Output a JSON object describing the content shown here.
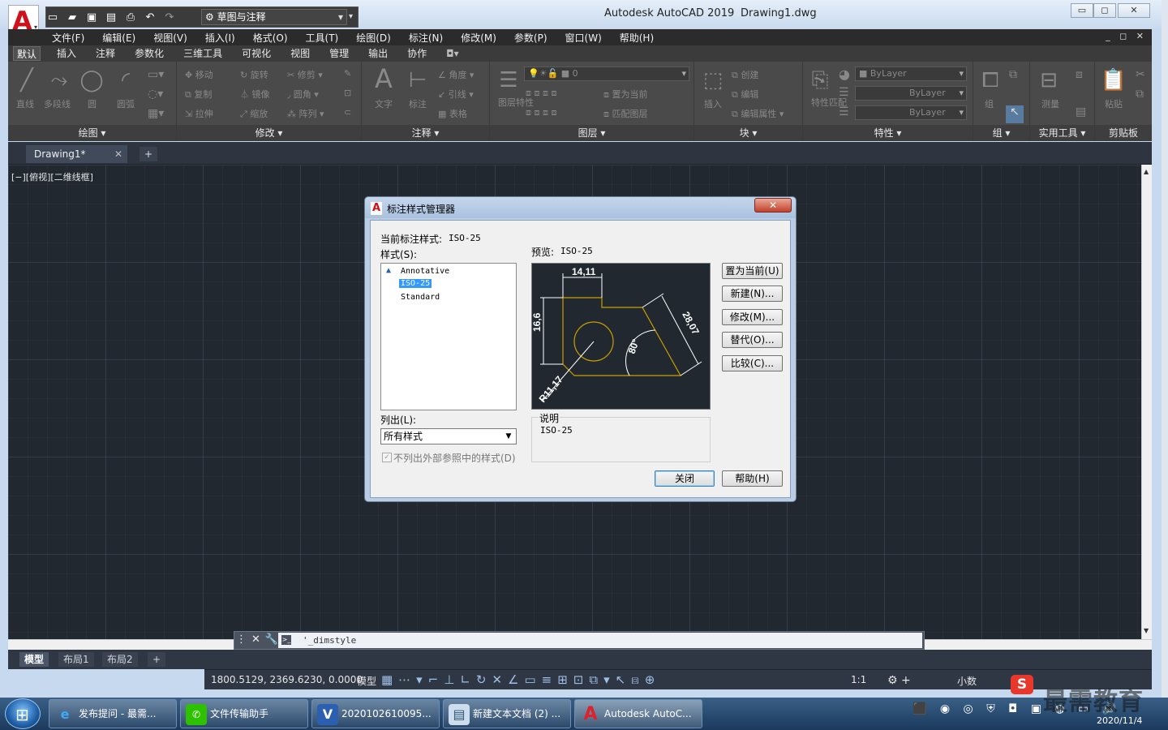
{
  "app": {
    "title": "Autodesk AutoCAD 2019",
    "file": "Drawing1.dwg",
    "workspace": "草图与注释"
  },
  "menu": [
    "文件(F)",
    "编辑(E)",
    "视图(V)",
    "插入(I)",
    "格式(O)",
    "工具(T)",
    "绘图(D)",
    "标注(N)",
    "修改(M)",
    "参数(P)",
    "窗口(W)",
    "帮助(H)"
  ],
  "ribbon_tabs": [
    "默认",
    "插入",
    "注释",
    "参数化",
    "三维工具",
    "可视化",
    "视图",
    "管理",
    "输出",
    "协作"
  ],
  "ribbon": {
    "draw": {
      "title": "绘图",
      "line": "直线",
      "polyline": "多段线",
      "circle": "圆",
      "arc": "圆弧"
    },
    "modify": {
      "title": "修改",
      "move": "移动",
      "rotate": "旋转",
      "trim": "修剪",
      "copy": "复制",
      "mirror": "镜像",
      "fillet": "圆角",
      "stretch": "拉伸",
      "scale": "缩放",
      "array": "阵列"
    },
    "annotation": {
      "title": "注释",
      "text": "文字",
      "dim": "标注",
      "linear": "线性",
      "leader": "引线",
      "table": "表格",
      "angle": "角度"
    },
    "layers": {
      "title": "图层",
      "props": "图层特性",
      "current_layer": "0",
      "set_current": "置为当前",
      "match": "匹配图层"
    },
    "block": {
      "title": "块",
      "insert": "插入",
      "create": "创建",
      "edit": "编辑",
      "edit_attr": "编辑属性"
    },
    "properties": {
      "title": "特性",
      "match": "特性匹配",
      "color": "ByLayer",
      "linetype": "ByLayer",
      "lineweight": "ByLayer"
    },
    "groups": {
      "title": "组",
      "group": "组"
    },
    "utilities": {
      "title": "实用工具",
      "measure": "测量"
    },
    "clipboard": {
      "title": "剪贴板",
      "paste": "粘贴"
    }
  },
  "doc_tab": "Drawing1*",
  "viewport_label": "[−][俯视][二维线框]",
  "command_line": "'_dimstyle",
  "layout_tabs": [
    "模型",
    "布局1",
    "布局2"
  ],
  "status": {
    "coords": "1800.5129, 2369.6230, 0.0000",
    "model": "模型",
    "scale": "1:1",
    "units": "小数"
  },
  "dialog": {
    "title": "标注样式管理器",
    "current_style_label": "当前标注样式:",
    "current_style": "ISO-25",
    "styles_label": "样式(S):",
    "styles": [
      "Annotative",
      "ISO-25",
      "Standard"
    ],
    "selected_style": "ISO-25",
    "preview_label": "预览:",
    "preview_style": "ISO-25",
    "list_label": "列出(L):",
    "list_value": "所有样式",
    "xref_checkbox": "不列出外部参照中的样式(D)",
    "description_label": "说明",
    "description": "ISO-25",
    "buttons": {
      "set_current": "置为当前(U)",
      "new": "新建(N)...",
      "modify": "修改(M)...",
      "override": "替代(O)...",
      "compare": "比较(C)...",
      "close": "关闭",
      "help": "帮助(H)"
    },
    "preview_dims": {
      "top": "14,11",
      "left": "16,6",
      "slant": "28,07",
      "angle": "80°",
      "radius": "R11,17"
    }
  },
  "taskbar": {
    "items": [
      "发布提问 - 最需...",
      "文件传输助手",
      "2020102610095...",
      "新建文本文档 (2) ...",
      "Autodesk AutoC..."
    ],
    "date": "2020/11/4"
  },
  "watermark": "最需教育",
  "colors": {
    "canvas": "#212830",
    "accent": "#3399ff",
    "preview_geometry": "#c8a000",
    "preview_dims": "#ffffff"
  }
}
